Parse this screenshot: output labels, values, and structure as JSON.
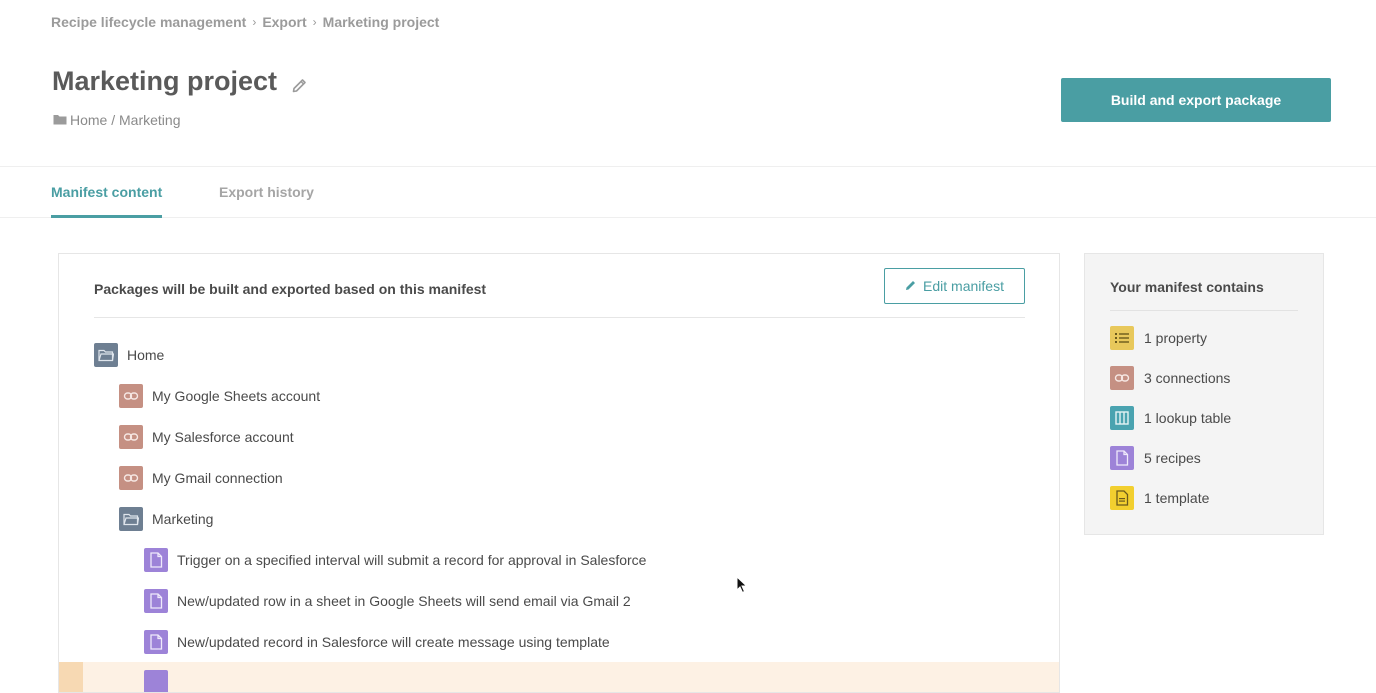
{
  "breadcrumb": {
    "items": [
      "Recipe lifecycle management",
      "Export",
      "Marketing project"
    ],
    "separator": "›"
  },
  "header": {
    "title": "Marketing project",
    "folder_path": "Home / Marketing",
    "primary_action": "Build and export package"
  },
  "tabs": [
    {
      "label": "Manifest content",
      "active": true
    },
    {
      "label": "Export history",
      "active": false
    }
  ],
  "manifest": {
    "description": "Packages will be built and exported based on this manifest",
    "edit_label": "Edit manifest",
    "items": [
      {
        "label": "Home",
        "icon": "folder-icon"
      },
      {
        "label": "My Google Sheets account",
        "icon": "connection-icon"
      },
      {
        "label": "My Salesforce account",
        "icon": "connection-icon"
      },
      {
        "label": "My Gmail connection",
        "icon": "connection-icon"
      },
      {
        "label": "Marketing",
        "icon": "folder-icon"
      },
      {
        "label": "Trigger on a specified interval will submit a record for approval in Salesforce",
        "icon": "recipe-icon"
      },
      {
        "label": "New/updated row in a sheet in Google Sheets will send email via Gmail 2",
        "icon": "recipe-icon"
      },
      {
        "label": "New/updated record in Salesforce will create message using template",
        "icon": "recipe-icon"
      }
    ]
  },
  "summary": {
    "title": "Your manifest contains",
    "items": [
      {
        "label": "1 property",
        "icon": "property-list-icon"
      },
      {
        "label": "3 connections",
        "icon": "connection-icon"
      },
      {
        "label": "1 lookup table",
        "icon": "lookup-table-icon"
      },
      {
        "label": "5 recipes",
        "icon": "recipe-icon"
      },
      {
        "label": "1 template",
        "icon": "template-icon"
      }
    ]
  },
  "colors": {
    "accent": "#4a9ea3",
    "folder": "#6e7f92",
    "connection": "#c59083",
    "recipe": "#9d83d8",
    "property": "#e8c85b",
    "lookup": "#4aa3b0",
    "template": "#f2cf2f"
  }
}
